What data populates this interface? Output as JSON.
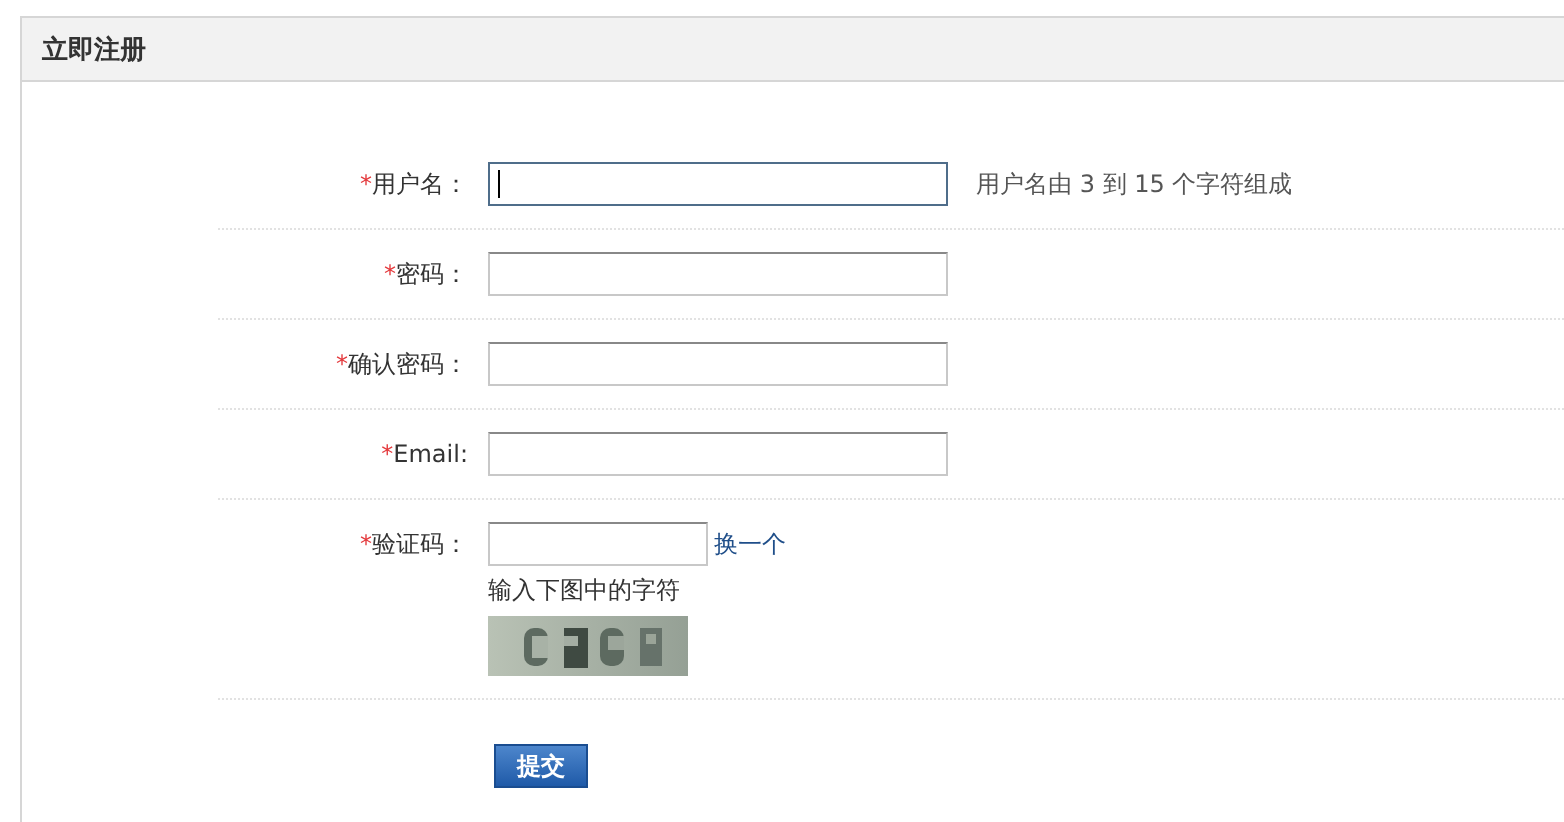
{
  "panel": {
    "title": "立即注册"
  },
  "fields": [
    {
      "kind": "text",
      "mark": "*",
      "label": "用户名：",
      "focused": true,
      "hint": "用户名由 3 到 15 个字符组成"
    },
    {
      "kind": "text",
      "mark": "*",
      "label": "密码：",
      "focused": false
    },
    {
      "kind": "text",
      "mark": "*",
      "label": "确认密码：",
      "focused": false
    },
    {
      "kind": "text",
      "mark": "*",
      "label": "Email:",
      "focused": false
    },
    {
      "kind": "captcha",
      "mark": "*",
      "label": "验证码：",
      "focused": false,
      "link": "换一个",
      "note": "输入下图中的字符"
    }
  ],
  "submit": "提交"
}
